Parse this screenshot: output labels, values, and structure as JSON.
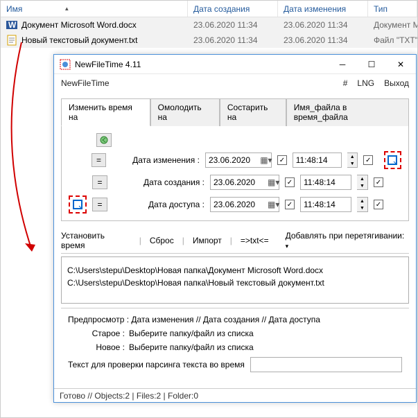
{
  "file_list": {
    "columns": {
      "name": "Имя",
      "created": "Дата создания",
      "modified": "Дата изменения",
      "type": "Тип"
    },
    "rows": [
      {
        "name": "Документ Microsoft Word.docx",
        "created": "23.06.2020 11:34",
        "modified": "23.06.2020 11:34",
        "type": "Документ Micros"
      },
      {
        "name": "Новый текстовый документ.txt",
        "created": "23.06.2020 11:34",
        "modified": "23.06.2020 11:34",
        "type": "Файл \"TXT\""
      }
    ]
  },
  "window": {
    "title": "NewFileTime 4.11",
    "menu": {
      "app": "NewFileTime",
      "hash": "#",
      "lng": "LNG",
      "exit": "Выход"
    },
    "tabs": [
      "Изменить время на",
      "Омолодить на",
      "Состарить на",
      "Имя_файла в время_файла"
    ],
    "labels": {
      "modified": "Дата изменения :",
      "created": "Дата создания :",
      "accessed": "Дата доступа :"
    },
    "date": "23.06.2020",
    "time": "11:48:14",
    "toolbar": {
      "set": "Установить время",
      "reset": "Сброс",
      "import": "Импорт",
      "txt": "=>txt<=",
      "drag": "Добавлять при перетягивании:"
    },
    "paths": [
      "C:\\Users\\stepu\\Desktop\\Новая папка\\Документ Microsoft Word.docx",
      "C:\\Users\\stepu\\Desktop\\Новая папка\\Новый текстовый документ.txt"
    ],
    "preview": {
      "header": "Предпросмотр :   Дата изменения   //   Дата создания   //   Дата доступа",
      "old_lbl": "Старое :",
      "old_val": "Выберите папку/файл из списка",
      "new_lbl": "Новое :",
      "new_val": "Выберите папку/файл из списка"
    },
    "parse_label": "Текст для проверки парсинга текста во время",
    "status": "Готово // Objects:2 | Files:2  | Folder:0"
  }
}
